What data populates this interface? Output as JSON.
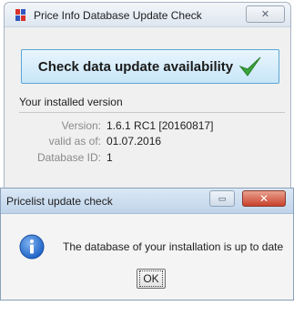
{
  "main_window": {
    "title": "Price Info Database Update Check",
    "close_label": "✕",
    "check_button_label": "Check data update availability",
    "installed_label": "Your installed version",
    "fields": [
      {
        "key": "Version:",
        "value": "1.6.1 RC1 [20160817]"
      },
      {
        "key": "valid as of:",
        "value": "01.07.2016"
      },
      {
        "key": "Database ID:",
        "value": "1"
      }
    ]
  },
  "dialog": {
    "title": "Pricelist update check",
    "restore_label": "▭",
    "close_label": "✕",
    "message": "The database of your installation is up to date",
    "ok_label": "OK"
  },
  "colors": {
    "accent_button": "#c8e6f8",
    "check_mark": "#3aa33a",
    "close_red": "#c8412b",
    "info_blue": "#1f63c6"
  }
}
